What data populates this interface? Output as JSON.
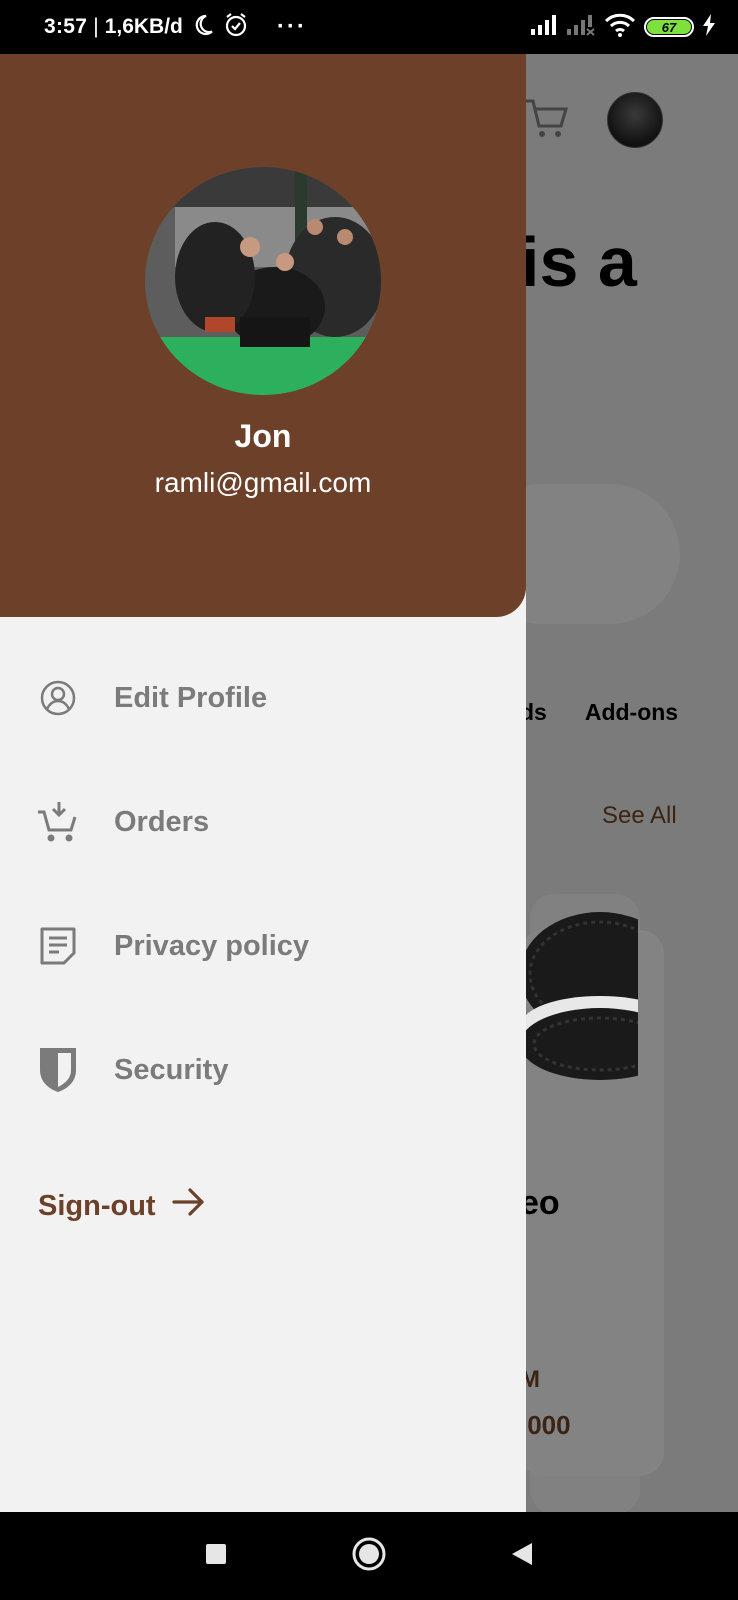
{
  "status_bar": {
    "time": "3:57",
    "separator": "|",
    "data_speed": "1,6KB/d",
    "more": "···",
    "battery_level": "67"
  },
  "background_app": {
    "heading_fragment": "is a",
    "tab_fragment": "ds",
    "tab_addons": "Add-ons",
    "see_all": "See All",
    "product_name_fragment": "eo",
    "price_label_fragment": "M",
    "price_fragment": ".000"
  },
  "drawer": {
    "user_name": "Jon",
    "user_email": "ramli@gmail.com",
    "menu": [
      {
        "label": "Edit Profile",
        "icon": "user-circle-icon"
      },
      {
        "label": "Orders",
        "icon": "cart-download-icon"
      },
      {
        "label": "Privacy policy",
        "icon": "document-icon"
      },
      {
        "label": "Security",
        "icon": "shield-icon"
      }
    ],
    "signout_label": "Sign-out"
  },
  "colors": {
    "brand_brown": "#6d4029",
    "drawer_bg": "#f2f2f2",
    "menu_text": "#7b7b7b",
    "battery_green": "#7ee03c"
  }
}
